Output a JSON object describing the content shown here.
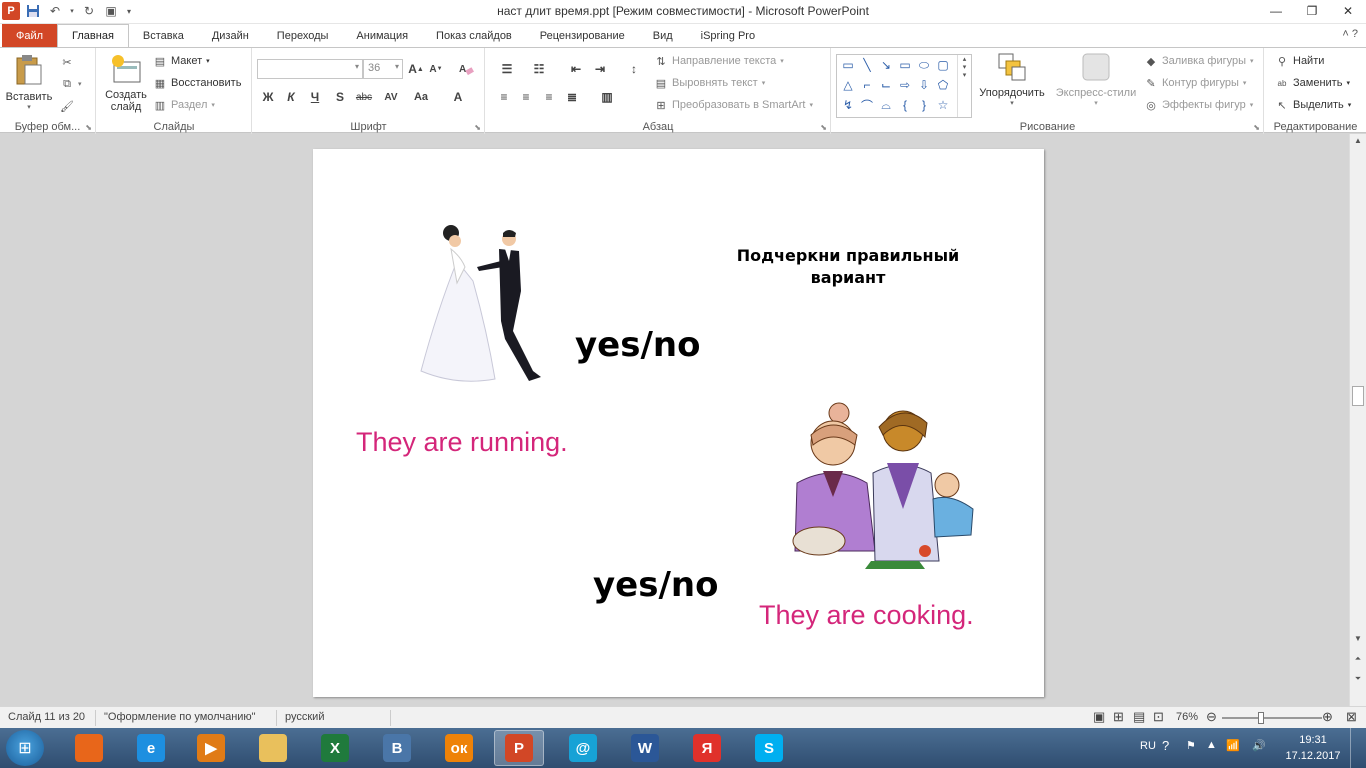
{
  "window": {
    "title": "наст длит время.ppt [Режим совместимости]  -  Microsoft PowerPoint",
    "app_icon": "P"
  },
  "tabs": [
    {
      "label": "Файл",
      "kind": "file"
    },
    {
      "label": "Главная",
      "kind": "active"
    },
    {
      "label": "Вставка",
      "kind": "normal"
    },
    {
      "label": "Дизайн",
      "kind": "normal"
    },
    {
      "label": "Переходы",
      "kind": "normal"
    },
    {
      "label": "Анимация",
      "kind": "normal"
    },
    {
      "label": "Показ слайдов",
      "kind": "normal"
    },
    {
      "label": "Рецензирование",
      "kind": "normal"
    },
    {
      "label": "Вид",
      "kind": "normal"
    },
    {
      "label": "iSpring Pro",
      "kind": "normal"
    }
  ],
  "ribbon": {
    "clipboard": {
      "label": "Буфер обм...",
      "paste": "Вставить"
    },
    "slides": {
      "label": "Слайды",
      "create": "Создать слайд",
      "layout": "Макет",
      "reset": "Восстановить",
      "section": "Раздел"
    },
    "font": {
      "label": "Шрифт",
      "font_name": "",
      "font_size": "36",
      "bold": "Ж",
      "italic": "К",
      "underline": "Ч",
      "shadow": "S",
      "strike": "abc",
      "spacing": "AV",
      "case": "Aa",
      "color": "A"
    },
    "paragraph": {
      "label": "Абзац",
      "text_direction": "Направление текста",
      "align_text": "Выровнять текст",
      "smartart": "Преобразовать в SmartArt"
    },
    "drawing": {
      "label": "Рисование",
      "arrange": "Упорядочить",
      "quick_styles": "Экспресс-стили",
      "fill": "Заливка фигуры",
      "outline": "Контур фигуры",
      "effects": "Эффекты фигур"
    },
    "editing": {
      "label": "Редактирование",
      "find": "Найти",
      "replace": "Заменить",
      "select": "Выделить"
    }
  },
  "slide": {
    "instruction": "Подчеркни правильный вариант",
    "yesno_1": "yes/no",
    "yesno_2": "yes/no",
    "sentence_1": "They are running.",
    "sentence_2": "They are cooking.",
    "sentence_color": "#d4267a"
  },
  "statusbar": {
    "slide_info": "Слайд 11 из 20",
    "theme": "\"Оформление по умолчанию\"",
    "language": "русский",
    "zoom": "76%"
  },
  "taskbar": {
    "apps": [
      {
        "name": "firefox-icon",
        "glyph": "",
        "color": "#e8661a"
      },
      {
        "name": "ie-icon",
        "glyph": "e",
        "color": "#1d8fe0"
      },
      {
        "name": "media-player-icon",
        "glyph": "▶",
        "color": "#e07b16"
      },
      {
        "name": "explorer-icon",
        "glyph": "",
        "color": "#e9c05c"
      },
      {
        "name": "excel-icon",
        "glyph": "X",
        "color": "#1f7a3c"
      },
      {
        "name": "vk-icon",
        "glyph": "В",
        "color": "#4a76a8"
      },
      {
        "name": "odnoklassniki-icon",
        "glyph": "ок",
        "color": "#ee8208"
      },
      {
        "name": "powerpoint-icon",
        "glyph": "P",
        "color": "#d24726"
      },
      {
        "name": "mail-agent-icon",
        "glyph": "@",
        "color": "#17a2d6"
      },
      {
        "name": "word-icon",
        "glyph": "W",
        "color": "#2b5797"
      },
      {
        "name": "yandex-icon",
        "glyph": "Я",
        "color": "#e0312b"
      },
      {
        "name": "skype-icon",
        "glyph": "S",
        "color": "#00aff0"
      }
    ],
    "lang": "RU",
    "time": "19:31",
    "date": "17.12.2017"
  }
}
